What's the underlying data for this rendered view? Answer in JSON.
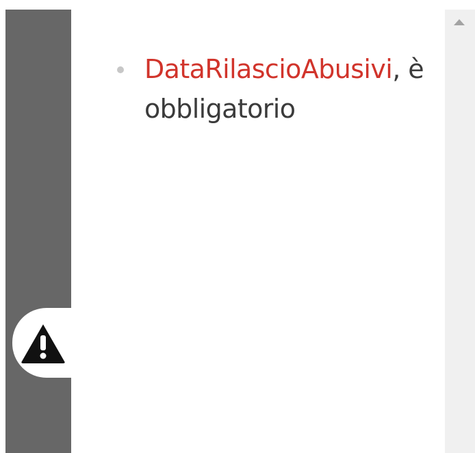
{
  "icons": {
    "warning": "warning-icon",
    "scroll_up": "scroll-up-arrow-icon",
    "bullet": "bullet-dot-icon"
  },
  "colors": {
    "rail": "#676767",
    "field_name": "#d1342b",
    "text": "#3b3b3b",
    "scrollbar": "#f0f0f0"
  },
  "messages": [
    {
      "field": "DataRilascioAbusivi",
      "text": ", è obbligatorio"
    }
  ]
}
